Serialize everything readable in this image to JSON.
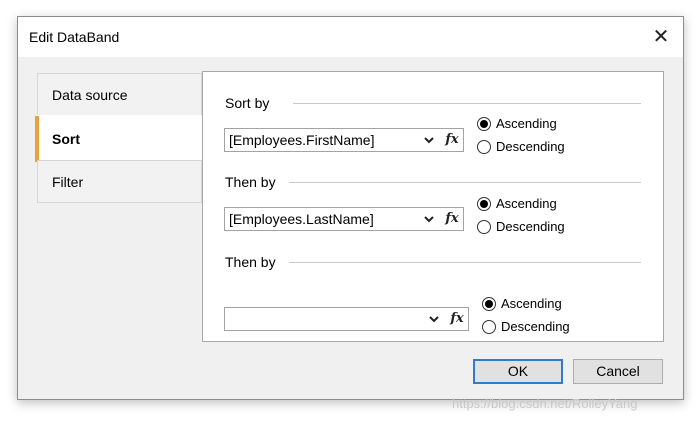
{
  "window": {
    "title": "Edit DataBand"
  },
  "tabs": [
    {
      "label": "Data source"
    },
    {
      "label": "Sort"
    },
    {
      "label": "Filter"
    }
  ],
  "sort_groups": [
    {
      "label": "Sort by",
      "field": "[Employees.FirstName]",
      "ascending": "Ascending",
      "descending": "Descending",
      "selected": "Ascending"
    },
    {
      "label": "Then by",
      "field": "[Employees.LastName]",
      "ascending": "Ascending",
      "descending": "Descending",
      "selected": "Ascending"
    },
    {
      "label": "Then by",
      "field": "",
      "ascending": "Ascending",
      "descending": "Descending",
      "selected": "Ascending"
    }
  ],
  "buttons": {
    "ok": "OK",
    "cancel": "Cancel"
  },
  "watermark": "https://blog.csdn.net/RolleyYang",
  "colors": {
    "accent": "#e8a23c",
    "default_button_border": "#2f7bd1"
  }
}
